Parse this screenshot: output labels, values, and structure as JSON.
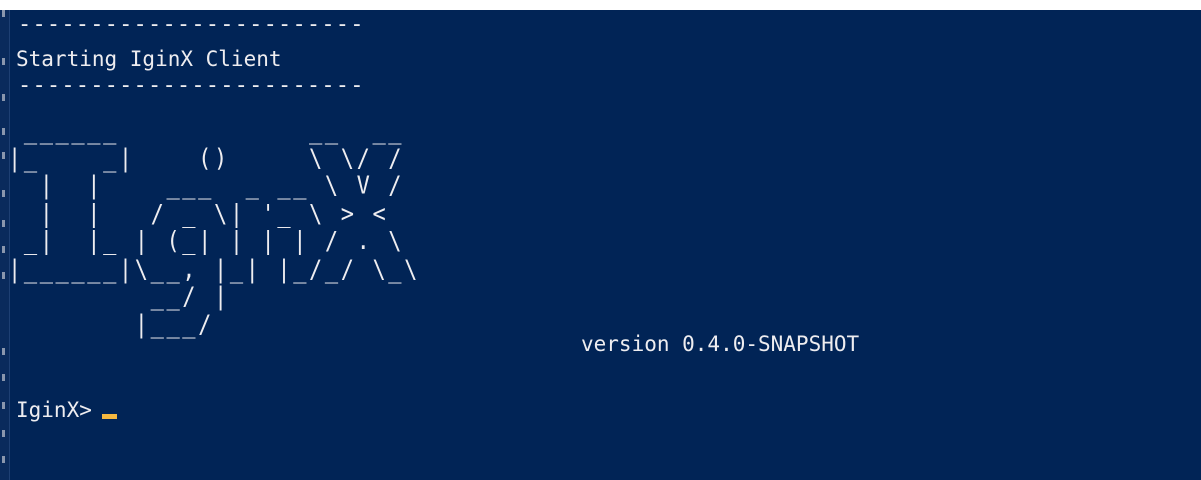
{
  "console": {
    "divider": "------------------------",
    "starting_message": "Starting IginX Client",
    "logo_art": " ______            __  __\n|_    _|    ()     \\ \\/ /\n  |  |    ___  _ __ \\ V /\n  |  |   / _ \\| '_ \\ > <\n _|  |_ | (_| | | | / . \\\n|______|\\__, |_| |_/_/ \\_\\\n         __/ |\n        |___/",
    "version_text": "version 0.4.0-SNAPSHOT",
    "prompt": "IginX>"
  },
  "colors": {
    "background": "#012456",
    "foreground": "#eeedf0",
    "cursor": "#f5b840"
  }
}
